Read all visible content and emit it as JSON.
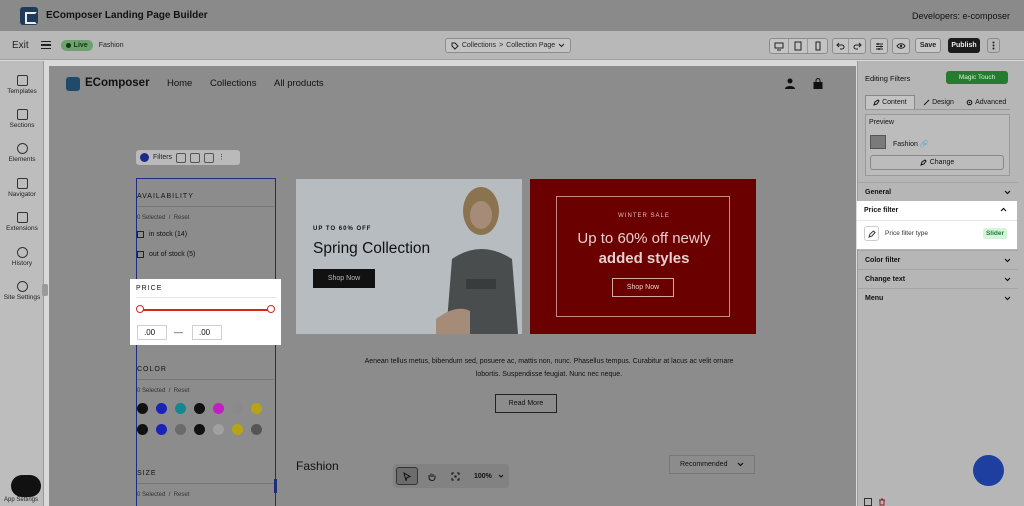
{
  "app": {
    "title": "EComposer Landing Page Builder",
    "developer": "Developers: e-composer"
  },
  "toolbar": {
    "exit": "Exit",
    "live": "Live",
    "page_name": "Fashion",
    "breadcrumb": {
      "first": "Collections",
      "separator": ">",
      "second": "Collection Page"
    },
    "save": "Save",
    "publish": "Publish"
  },
  "sidebar": {
    "items": [
      {
        "label": "Templates",
        "icon": "templates-icon"
      },
      {
        "label": "Sections",
        "icon": "sections-icon"
      },
      {
        "label": "Elements",
        "icon": "elements-icon"
      },
      {
        "label": "Navigator",
        "icon": "navigator-icon"
      },
      {
        "label": "Extensions",
        "icon": "extensions-icon"
      },
      {
        "label": "History",
        "icon": "history-icon"
      },
      {
        "label": "Site Settings",
        "icon": "site-settings-icon"
      }
    ],
    "app_embed": "App Settings"
  },
  "store": {
    "logo": "EComposer",
    "nav": [
      "Home",
      "Collections",
      "All products"
    ]
  },
  "filters": {
    "toolbar_label": "Filters",
    "availability": {
      "heading": "AVAILABILITY",
      "selected": "0 Selected",
      "separator": "/",
      "reset": "Reset",
      "options": [
        "in stock (14)",
        "out of stock (5)"
      ]
    },
    "price": {
      "heading": "PRICE",
      "min": ".00",
      "dash": "—",
      "max": ".00",
      "range_low": 0,
      "range_high": 1
    },
    "color": {
      "heading": "COLOR",
      "selected": "0 Selected",
      "separator": "/",
      "reset": "Reset",
      "swatches_row1": [
        "#111111",
        "#1a23b8",
        "#12888f",
        "#111111",
        "#c21fc2",
        "#8a8a8a",
        "#b8a412"
      ],
      "swatches_row2": [
        "#111111",
        "#1a23b8",
        "#6a6a6a",
        "#111111",
        "#a0a0a0",
        "#b8a412",
        "#555555"
      ]
    },
    "size": {
      "heading": "SIZE",
      "selected": "0 Selected",
      "separator": "/",
      "reset": "Reset"
    }
  },
  "banners": {
    "left": {
      "tag": "UP TO 60% OFF",
      "title": "Spring Collection",
      "button": "Shop Now"
    },
    "right": {
      "tag": "WINTER SALE",
      "title_line1": "Up to 60% off newly",
      "title_line2": "added styles",
      "button": "Shop Now"
    }
  },
  "content": {
    "description": "Aenean tellus metus, bibendum sed, posuere ac, mattis non, nunc. Phasellus tempus. Curabitur at lacus ac velit ornare lobortis. Suspendisse feugiat. Nunc nec neque.",
    "read_more": "Read More",
    "section_title": "Fashion",
    "sort": "Recommended"
  },
  "zoom": {
    "level": "100%"
  },
  "panel": {
    "title": "Editing Filters",
    "magic": "Magic Touch",
    "tabs": [
      "Content",
      "Design",
      "Advanced"
    ],
    "preview_label": "Preview",
    "preview_page": "Fashion",
    "change": "Change",
    "sections": {
      "general": "General",
      "price_filter": "Price filter",
      "price_filter_type_label": "Price filter type",
      "price_filter_type_value": "Slider",
      "color_filter": "Color filter",
      "change_text": "Change text",
      "menu": "Menu"
    }
  }
}
